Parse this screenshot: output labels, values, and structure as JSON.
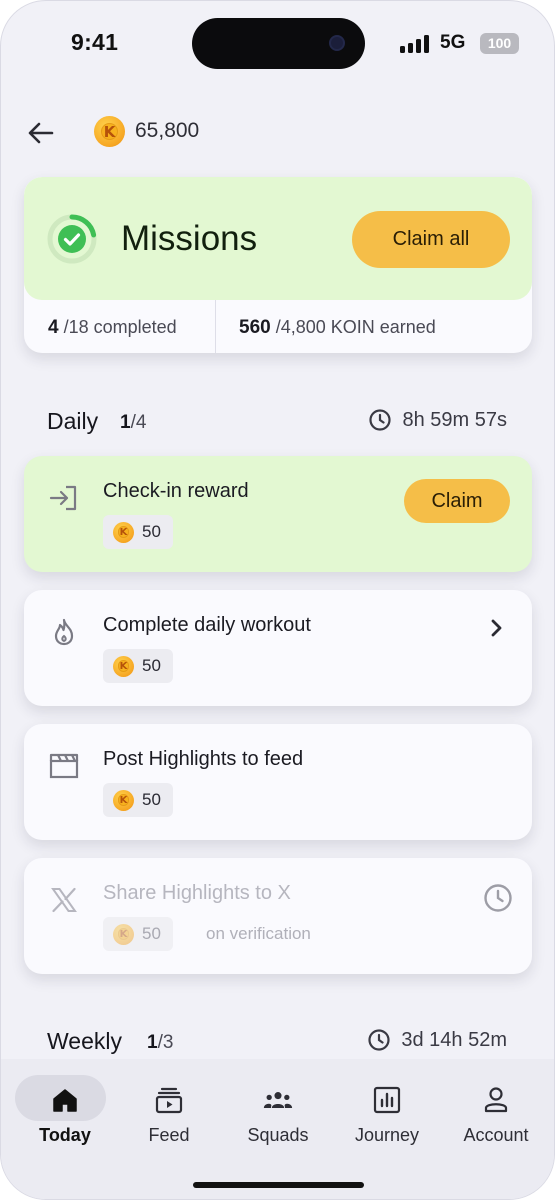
{
  "status_bar": {
    "time": "9:41",
    "network": "5G",
    "battery": "100"
  },
  "header": {
    "balance": "65,800",
    "back_icon": "arrow-left-icon",
    "coin_icon": "koin-coin-icon"
  },
  "missions": {
    "title": "Missions",
    "claim_all_label": "Claim all",
    "completed_count": "4",
    "completed_total": "/18 completed",
    "earned_amount": "560",
    "earned_total": "/4,800 KOIN earned",
    "progress_fraction": 0.22,
    "accent_color": "#f5be48",
    "highlight_color": "#e3f8d2"
  },
  "daily": {
    "name": "Daily",
    "done": "1",
    "total": "/4",
    "timer": "8h 59m 57s",
    "tasks": [
      {
        "title": "Check-in reward",
        "reward": "50",
        "icon": "sign-in-icon",
        "action_label": "Claim"
      },
      {
        "title": "Complete daily workout",
        "reward": "50",
        "icon": "flame-icon"
      },
      {
        "title": "Post Highlights to feed",
        "reward": "50",
        "icon": "clapperboard-icon"
      },
      {
        "title": "Share Highlights to X",
        "reward": "50",
        "note": "on verification",
        "icon": "x-logo-icon"
      }
    ]
  },
  "weekly": {
    "name": "Weekly",
    "done": "1",
    "total": "/3",
    "timer": "3d 14h 52m"
  },
  "tabs": [
    {
      "label": "Today",
      "icon": "home-icon",
      "active": true
    },
    {
      "label": "Feed",
      "icon": "feed-icon"
    },
    {
      "label": "Squads",
      "icon": "group-icon"
    },
    {
      "label": "Journey",
      "icon": "chart-icon"
    },
    {
      "label": "Account",
      "icon": "user-icon"
    }
  ]
}
